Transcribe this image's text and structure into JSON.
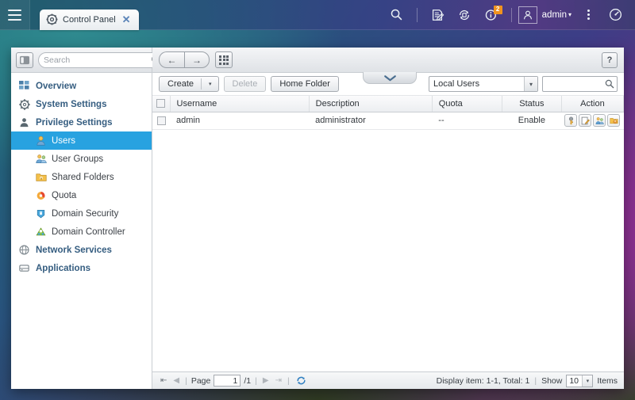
{
  "topbar": {
    "menu_icon": "hamburger-icon",
    "tab": {
      "icon": "gear-icon",
      "label": "Control Panel",
      "close": "✕"
    },
    "icons": [
      {
        "name": "search-icon"
      },
      {
        "name": "file-log-icon"
      },
      {
        "name": "sync-refresh-icon"
      },
      {
        "name": "info-icon",
        "badge": "2"
      },
      {
        "name": "user-avatar-icon"
      },
      {
        "name": "more-options-icon"
      },
      {
        "name": "dashboard-speedometer-icon"
      }
    ],
    "username": "admin",
    "caret": "▾"
  },
  "sidebar": {
    "panel_toggle_icon": "panel-toggle-icon",
    "search": {
      "placeholder": "Search",
      "value": "",
      "icon": "search-icon"
    },
    "items": [
      {
        "label": "Overview",
        "icon": "overview-grid-icon",
        "level": "top",
        "selected": false
      },
      {
        "label": "System Settings",
        "icon": "gear-icon",
        "level": "top",
        "selected": false
      },
      {
        "label": "Privilege Settings",
        "icon": "person-icon",
        "level": "top",
        "selected": false
      },
      {
        "label": "Users",
        "icon": "user-icon",
        "level": "sub",
        "selected": true
      },
      {
        "label": "User Groups",
        "icon": "users-group-icon",
        "level": "sub",
        "selected": false
      },
      {
        "label": "Shared Folders",
        "icon": "shared-folder-icon",
        "level": "sub",
        "selected": false
      },
      {
        "label": "Quota",
        "icon": "quota-pie-icon",
        "level": "sub",
        "selected": false
      },
      {
        "label": "Domain Security",
        "icon": "domain-security-icon",
        "level": "sub",
        "selected": false
      },
      {
        "label": "Domain Controller",
        "icon": "domain-controller-icon",
        "level": "sub",
        "selected": false
      },
      {
        "label": "Network Services",
        "icon": "globe-icon",
        "level": "top",
        "selected": false
      },
      {
        "label": "Applications",
        "icon": "applications-icon",
        "level": "top",
        "selected": false
      }
    ]
  },
  "content": {
    "nav": {
      "back_icon": "arrow-left-icon",
      "forward_icon": "arrow-right-icon",
      "grid_icon": "grid-apps-icon"
    },
    "help_label": "?",
    "collapse_icon": "chevron-down-icon",
    "toolbar": {
      "create_label": "Create",
      "create_caret": "▾",
      "delete_label": "Delete",
      "home_folder_label": "Home Folder",
      "user_scope": "Local Users",
      "user_scope_caret": "▾",
      "search_value": "",
      "search_icon": "search-icon"
    },
    "table": {
      "columns": [
        "Username",
        "Description",
        "Quota",
        "Status",
        "Action"
      ],
      "rows": [
        {
          "username": "admin",
          "description": "administrator",
          "quota": "--",
          "status": "Enable",
          "actions": [
            "change-password-icon",
            "edit-account-icon",
            "edit-user-groups-icon",
            "edit-shared-folder-permission-icon"
          ]
        }
      ]
    },
    "pager": {
      "first_icon": "first-page-icon",
      "prev_icon": "prev-page-icon",
      "page_label": "Page",
      "page_value": "1",
      "total_pages": "/1",
      "next_icon": "next-page-icon",
      "last_icon": "last-page-icon",
      "refresh_icon": "refresh-icon",
      "display_info": "Display item: 1-1, Total: 1",
      "separator": "|",
      "show_label": "Show",
      "show_value": "10",
      "show_caret": "▾",
      "items_label": "Items"
    }
  },
  "colors": {
    "accent": "#28a2e0",
    "badge": "#f0931e",
    "sidebar_heading": "#355d80"
  }
}
